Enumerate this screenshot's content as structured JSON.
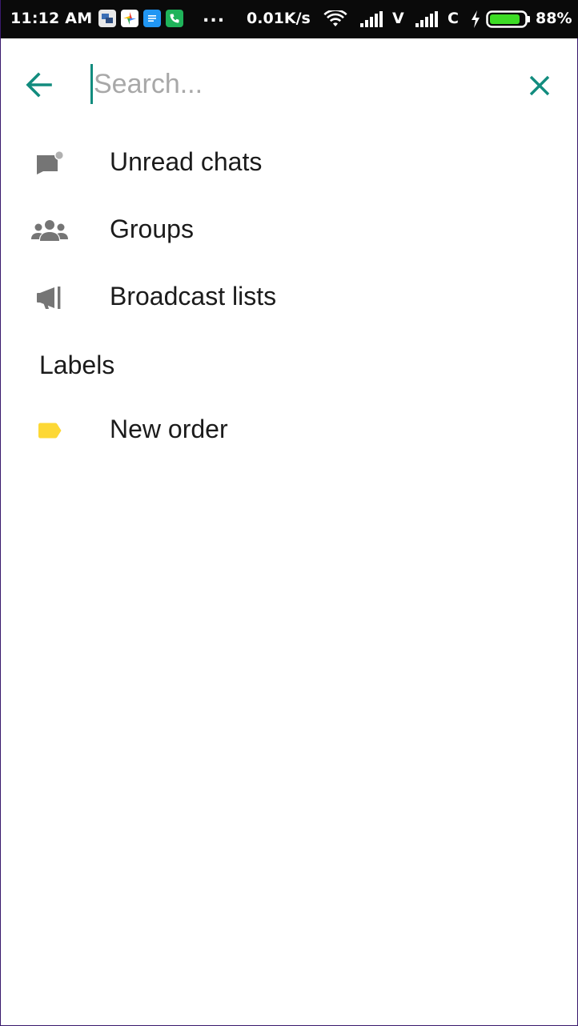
{
  "status_bar": {
    "time": "11:12 AM",
    "dots": "...",
    "net_speed": "0.01K/s",
    "sim1_label": "V",
    "sim2_label": "C",
    "battery_pct": "88%",
    "battery_level": 0.88
  },
  "search": {
    "placeholder": "Search...",
    "value": ""
  },
  "filters": [
    {
      "label": "Unread chats",
      "icon": "unread-chats-icon"
    },
    {
      "label": "Groups",
      "icon": "groups-icon"
    },
    {
      "label": "Broadcast lists",
      "icon": "broadcast-icon"
    }
  ],
  "labels_section": {
    "title": "Labels",
    "items": [
      {
        "label": "New order",
        "icon": "label-tag-icon",
        "color": "#fdd835"
      }
    ]
  },
  "colors": {
    "accent": "#128c7e",
    "icon_gray": "#757575",
    "status_bar_bg": "#0a0a0a",
    "battery_green": "#3ddc25"
  }
}
